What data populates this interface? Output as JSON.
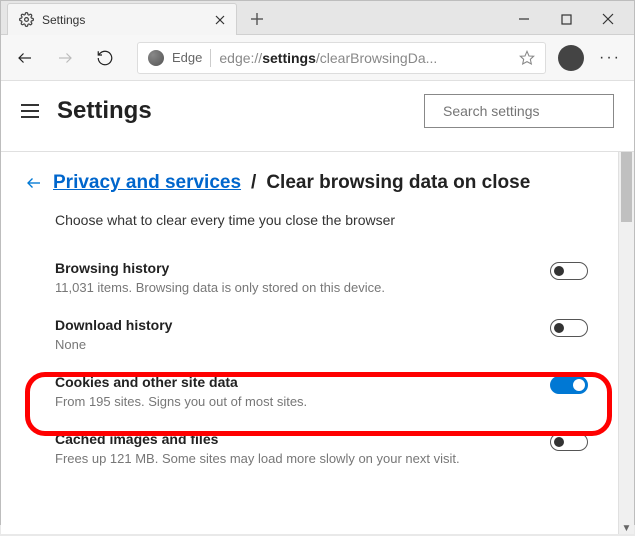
{
  "window": {
    "tab_title": "Settings"
  },
  "toolbar": {
    "edge_label": "Edge",
    "url_prefix": "edge://",
    "url_bold": "settings",
    "url_rest": "/clearBrowsingDa..."
  },
  "header": {
    "title": "Settings",
    "search_placeholder": "Search settings"
  },
  "breadcrumb": {
    "link": "Privacy and services",
    "sep": "/",
    "current": "Clear browsing data on close"
  },
  "description": "Choose what to clear every time you close the browser",
  "settings": [
    {
      "title": "Browsing history",
      "sub": "11,031 items. Browsing data is only stored on this device.",
      "on": false
    },
    {
      "title": "Download history",
      "sub": "None",
      "on": false
    },
    {
      "title": "Cookies and other site data",
      "sub": "From 195 sites. Signs you out of most sites.",
      "on": true
    },
    {
      "title": "Cached images and files",
      "sub": "Frees up 121 MB. Some sites may load more slowly on your next visit.",
      "on": false
    }
  ]
}
